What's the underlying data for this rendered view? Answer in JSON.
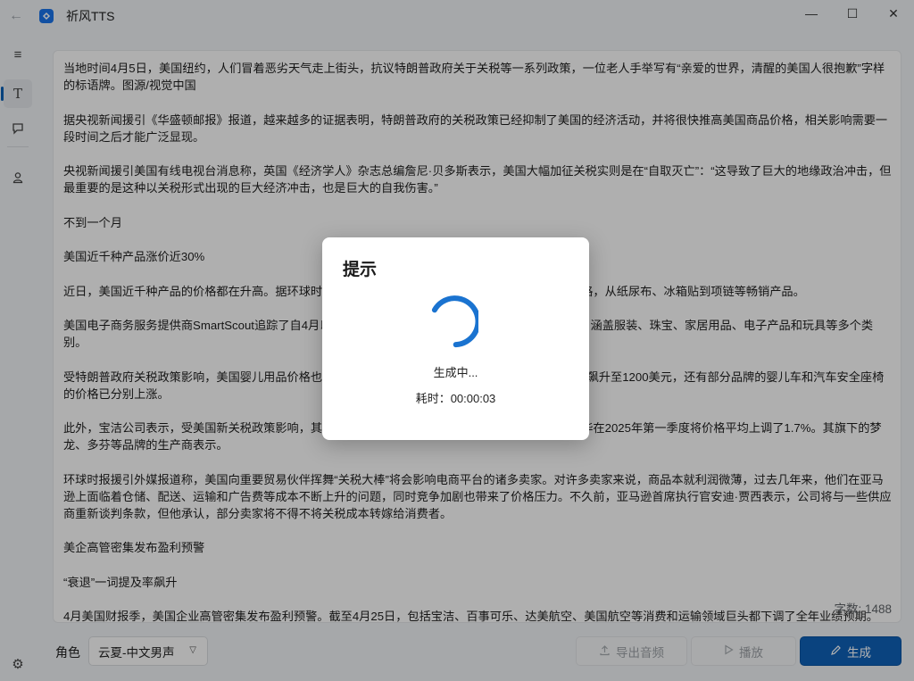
{
  "window": {
    "title": "祈风TTS",
    "controls": {
      "minimize": "—",
      "maximize": "☐",
      "close": "✕"
    }
  },
  "sidebar": {
    "items": [
      {
        "name": "menu-icon",
        "glyph": "≡"
      },
      {
        "name": "text-icon",
        "glyph": "T"
      },
      {
        "name": "chat-icon",
        "glyph": "◌"
      },
      {
        "name": "user-icon",
        "glyph": "♙"
      }
    ],
    "settings_glyph": "⚙"
  },
  "content": {
    "paragraphs": [
      "当地时间4月5日，美国纽约，人们冒着恶劣天气走上街头，抗议特朗普政府关于关税等一系列政策，一位老人手举写有“亲爱的世界，清醒的美国人很抱歉”字样的标语牌。图源/视觉中国",
      "据央视新闻援引《华盛顿邮报》报道，越来越多的证据表明，特朗普政府的关税政策已经抑制了美国的经济活动，并将很快推高美国商品价格，相关影响需要一段时间之后才能广泛显现。",
      "央视新闻援引美国有线电视台消息称，英国《经济学人》杂志总编詹尼·贝多斯表示，美国大幅加征关税实则是在“自取灭亡”：“这导致了巨大的地缘政治冲击，但最重要的是这种以关税形式出现的巨大经济冲击，也是巨大的自我伤害。”",
      "不到一个月",
      "美国近千种产品涨价近30%",
      "近日，美国近千种产品的价格都在升高。据环球时报援引外媒报道，美国商家正在提高多种商品的价格，从纸尿布、冰箱贴到项链等畅销产品。",
      "美国电子商务服务提供商SmartScout追踪了自4月以来美国近千种商品价格，价格上涨幅度达到29%，涵盖服装、珠宝、家居用品、电子产品和玩具等多个类别。",
      "受特朗普政府关税政策影响，美国婴儿用品价格也显著上涨，其中UPPAbaby婴儿车价格将从899美元飙升至1200美元，还有部分品牌的婴儿车和汽车安全座椅的价格已分别上涨。",
      "此外，宝洁公司表示，受美国新关税政策影响，其将在未来几个月内在美国市场上再次提价。联合利华在2025年第一季度将价格平均上调了1.7%。其旗下的梦龙、多芬等品牌的生产商表示。",
      "环球时报援引外媒报道称，美国向重要贸易伙伴挥舞“关税大棒”将会影响电商平台的诸多卖家。对许多卖家来说，商品本就利润微薄，过去几年来，他们在亚马逊上面临着仓储、配送、运输和广告费等成本不断上升的问题，同时竞争加剧也带来了价格压力。不久前，亚马逊首席执行官安迪·贾西表示，公司将与一些供应商重新谈判条款，但他承认，部分卖家将不得不将关税成本转嫁给消费者。",
      "美企高管密集发布盈利预警",
      "“衰退”一词提及率飙升",
      "4月美国财报季，美国企业高管密集发布盈利预警。截至4月25日，包括宝洁、百事可乐、达美航空、美国航空等消费和运输领域巨头都下调了全年业绩预期。"
    ],
    "char_count": "字数: 1488"
  },
  "bottom": {
    "role_label": "角色",
    "role_value": "云夏-中文男声",
    "export_label": "导出音频",
    "play_label": "播放",
    "generate_label": "生成"
  },
  "dialog": {
    "title": "提示",
    "status": "生成中...",
    "elapsed": "耗时：00:00:03"
  },
  "colors": {
    "accent": "#0f60b6",
    "spinner": "#1a73d0"
  }
}
